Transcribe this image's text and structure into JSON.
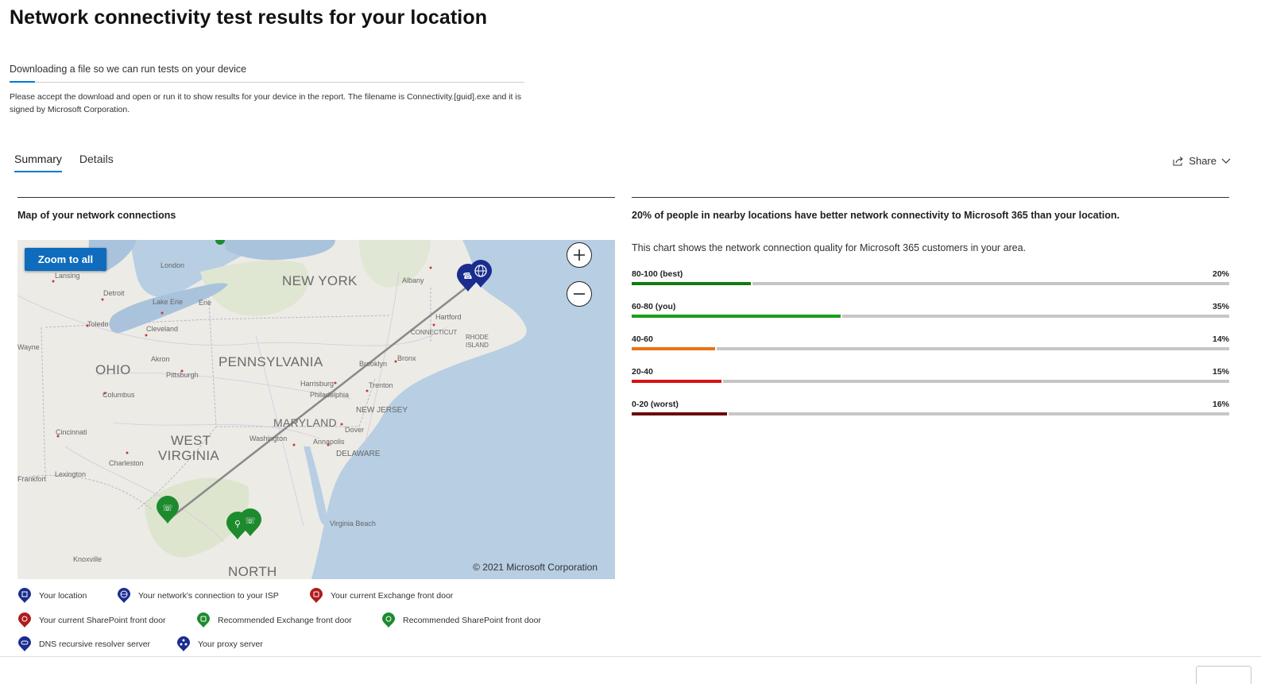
{
  "page": {
    "title": "Network connectivity test results for your location"
  },
  "download": {
    "status": "Downloading a file so we can run tests on your device",
    "progress_percent": 5,
    "note": "Please accept the download and open or run it to show results for your device in the report. The filename is Connectivity.[guid].exe and it is signed by Microsoft Corporation."
  },
  "tabs": [
    {
      "label": "Summary",
      "active": true
    },
    {
      "label": "Details",
      "active": false
    }
  ],
  "share": {
    "label": "Share",
    "icon": "share-icon"
  },
  "map": {
    "title": "Map of your network connections",
    "zoom_all_label": "Zoom to all",
    "copyright": "© 2021 Microsoft Corporation",
    "states": [
      "NEW YORK",
      "PENNSYLVANIA",
      "OHIO",
      "WEST",
      "VIRGINIA",
      "MARYLAND",
      "NEW JERSEY",
      "DELAWARE",
      "NORTH"
    ],
    "cities": [
      "Lansing",
      "London",
      "Detroit",
      "Lake Erie",
      "Erie",
      "Toledo",
      "Cleveland",
      "Akron",
      "Pittsburgh",
      "Columbus",
      "Cincinnati",
      "Charleston",
      "Lexington",
      "Frankfort",
      "Wayne",
      "Albany",
      "Hartford",
      "CONNECTICUT",
      "RHODE",
      "ISLAND",
      "Brooklyn",
      "Bronx",
      "Harrisburg",
      "Philadelphia",
      "Trenton",
      "Washington",
      "Annapolis",
      "Dover",
      "Virginia Beach",
      "Knoxville"
    ]
  },
  "legend": [
    {
      "label": "Your location",
      "icon": "building-pin-icon",
      "color": "#1a2d8f"
    },
    {
      "label": "Your network's connection to your ISP",
      "icon": "globe-pin-icon",
      "color": "#1a2d8f"
    },
    {
      "label": "Your current Exchange front door",
      "icon": "exchange-pin-icon",
      "color": "#b01c1c"
    },
    {
      "label": "Your current SharePoint front door",
      "icon": "sharepoint-pin-icon",
      "color": "#b01c1c"
    },
    {
      "label": "Recommended Exchange front door",
      "icon": "exchange-pin-icon",
      "color": "#1e8a2e"
    },
    {
      "label": "Recommended SharePoint front door",
      "icon": "sharepoint-pin-icon",
      "color": "#1e8a2e"
    },
    {
      "label": "DNS recursive resolver server",
      "icon": "dns-pin-icon",
      "color": "#1a2d8f"
    },
    {
      "label": "Your proxy server",
      "icon": "proxy-pin-icon",
      "color": "#1a2d8f"
    }
  ],
  "summary": {
    "heading": "20% of people in nearby locations have better network connectivity to Microsoft 365 than your location.",
    "chart_description": "This chart shows the network connection quality for Microsoft 365 customers in your area."
  },
  "quality_bars": [
    {
      "label": "80-100 (best)",
      "value_text": "20%",
      "value": 20,
      "color": "#107c10"
    },
    {
      "label": "60-80 (you)",
      "value_text": "35%",
      "value": 35,
      "color": "#1a9e1a"
    },
    {
      "label": "40-60",
      "value_text": "14%",
      "value": 14,
      "color": "#e8731a"
    },
    {
      "label": "20-40",
      "value_text": "15%",
      "value": 15,
      "color": "#d41414"
    },
    {
      "label": "0-20 (worst)",
      "value_text": "16%",
      "value": 16,
      "color": "#6b0a0a"
    }
  ]
}
